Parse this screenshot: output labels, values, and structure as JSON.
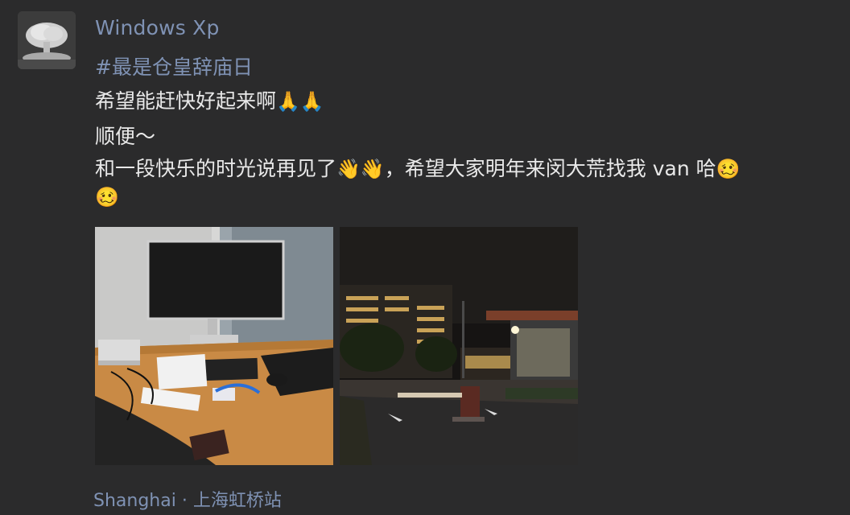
{
  "post": {
    "author": "Windows Xp",
    "hashtag": "#最是仓皇辞庙日",
    "lines": [
      "希望能赶快好起来啊",
      "顺便～",
      "和一段快乐的时光说再见了",
      "，希望大家明年来闵大荒找我 van 哈"
    ],
    "emojis": {
      "pray": "🙏",
      "wave": "👋",
      "smirk": "🥴"
    },
    "location": "Shanghai · 上海虹桥站"
  },
  "photos": [
    {
      "subject": "office-desk-photo"
    },
    {
      "subject": "night-campus-gate-photo"
    }
  ]
}
